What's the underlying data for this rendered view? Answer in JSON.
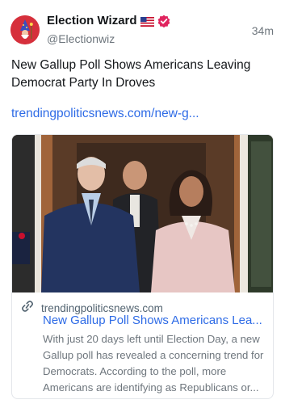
{
  "post": {
    "author_name": "Election Wizard",
    "flag_emoji": "🇺🇸",
    "handle": "@Electionwiz",
    "time": "34m",
    "text": "New Gallup Poll Shows Americans Leaving Democrat Party In Droves",
    "link_text": "trendingpoliticsnews.com/new-g..."
  },
  "card": {
    "domain": "trendingpoliticsnews.com",
    "title": "New Gallup Poll Shows Americans Lea...",
    "description": "With just 20 days left until Election Day, a new Gallup poll has revealed a concerning trend for Democrats. According to the poll, more Americans are identifying as Republicans or..."
  },
  "icons": {
    "avatar": "wizard-avatar-icon",
    "verified": "verified-badge-icon",
    "link": "link-icon"
  },
  "colors": {
    "link": "#2e6be6",
    "muted": "#6e767d",
    "verified": "#e0245e",
    "avatar_bg": "#d6303c"
  }
}
